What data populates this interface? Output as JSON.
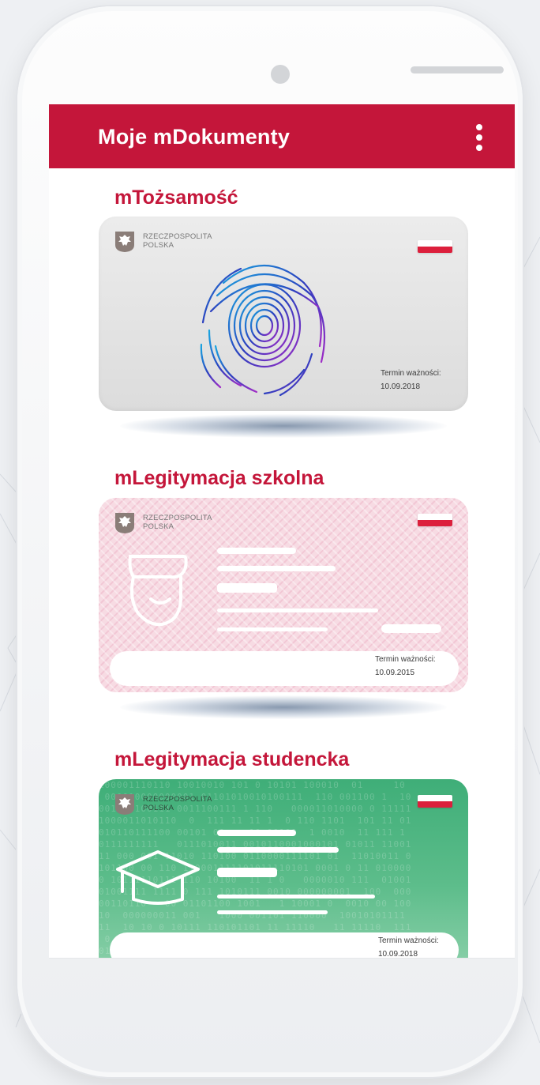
{
  "app_bar": {
    "title": "Moje mDokumenty",
    "menu_icon": "more-vert-icon"
  },
  "colors": {
    "brand": "#c4163a",
    "flag_red": "#dc1f3c",
    "grey_card": "#e4e4e4",
    "pink_card": "#f7dbe3",
    "green_card": "#4cb37f"
  },
  "issuer": {
    "line1": "RZECZPOSPOLITA",
    "line2": "POLSKA"
  },
  "documents": [
    {
      "section_title": "mTożsamość",
      "icon": "fingerprint-icon",
      "expiry_label": "Termin ważności:",
      "expiry_date": "10.09.2018"
    },
    {
      "section_title": "mLegitymacja szkolna",
      "icon": "student-face-icon",
      "expiry_label": "Termin ważności:",
      "expiry_date": "10.09.2015"
    },
    {
      "section_title": "mLegitymacja studencka",
      "icon": "graduation-cap-icon",
      "expiry_label": "Termin ważności:",
      "expiry_date": "10.09.2018"
    }
  ]
}
